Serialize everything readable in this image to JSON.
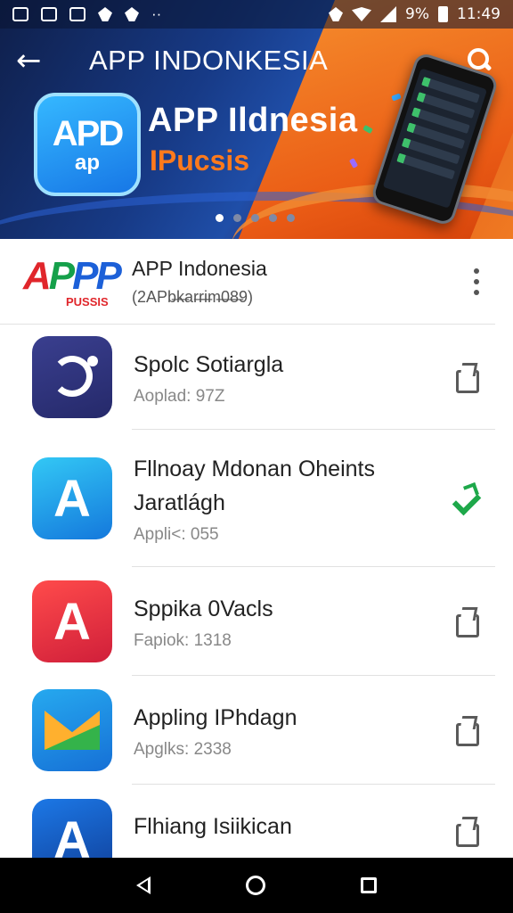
{
  "status_bar": {
    "battery_percent": "9%",
    "time": "11:49"
  },
  "toolbar": {
    "title": "APP INDONKESIA"
  },
  "banner": {
    "logo_line1": "APD",
    "logo_line2": "ap",
    "title": "APP Ildnesia",
    "subtitle": "IPucsis",
    "carousel_total": 5,
    "carousel_active_index": 0
  },
  "featured": {
    "logo_text": "APPP",
    "logo_subtext": "PUSSIS",
    "name": "APP Indonesia",
    "subtitle": "(2APb̶k̶ar̶r̶i̶m̶0̶8̶9)"
  },
  "apps": [
    {
      "name": "Spolc Sotiargla",
      "sub": "Aoplad: 97Z",
      "action": "share"
    },
    {
      "name": "Fllnoay Mdonan Oheints Jaratlágh",
      "sub": "Appli<: 055",
      "action": "installed"
    },
    {
      "name": "Sppika 0Vacls",
      "sub": "Fapiok: 1318",
      "action": "share"
    },
    {
      "name": "Appling IPhdagn",
      "sub": "Apglks: 2338",
      "action": "share"
    },
    {
      "name": "Flhiang Isiikican",
      "sub": "",
      "action": "share"
    }
  ],
  "colors": {
    "banner_blue": "#1f4ea8",
    "banner_orange": "#f07a22",
    "installed_green": "#1ea84a"
  }
}
